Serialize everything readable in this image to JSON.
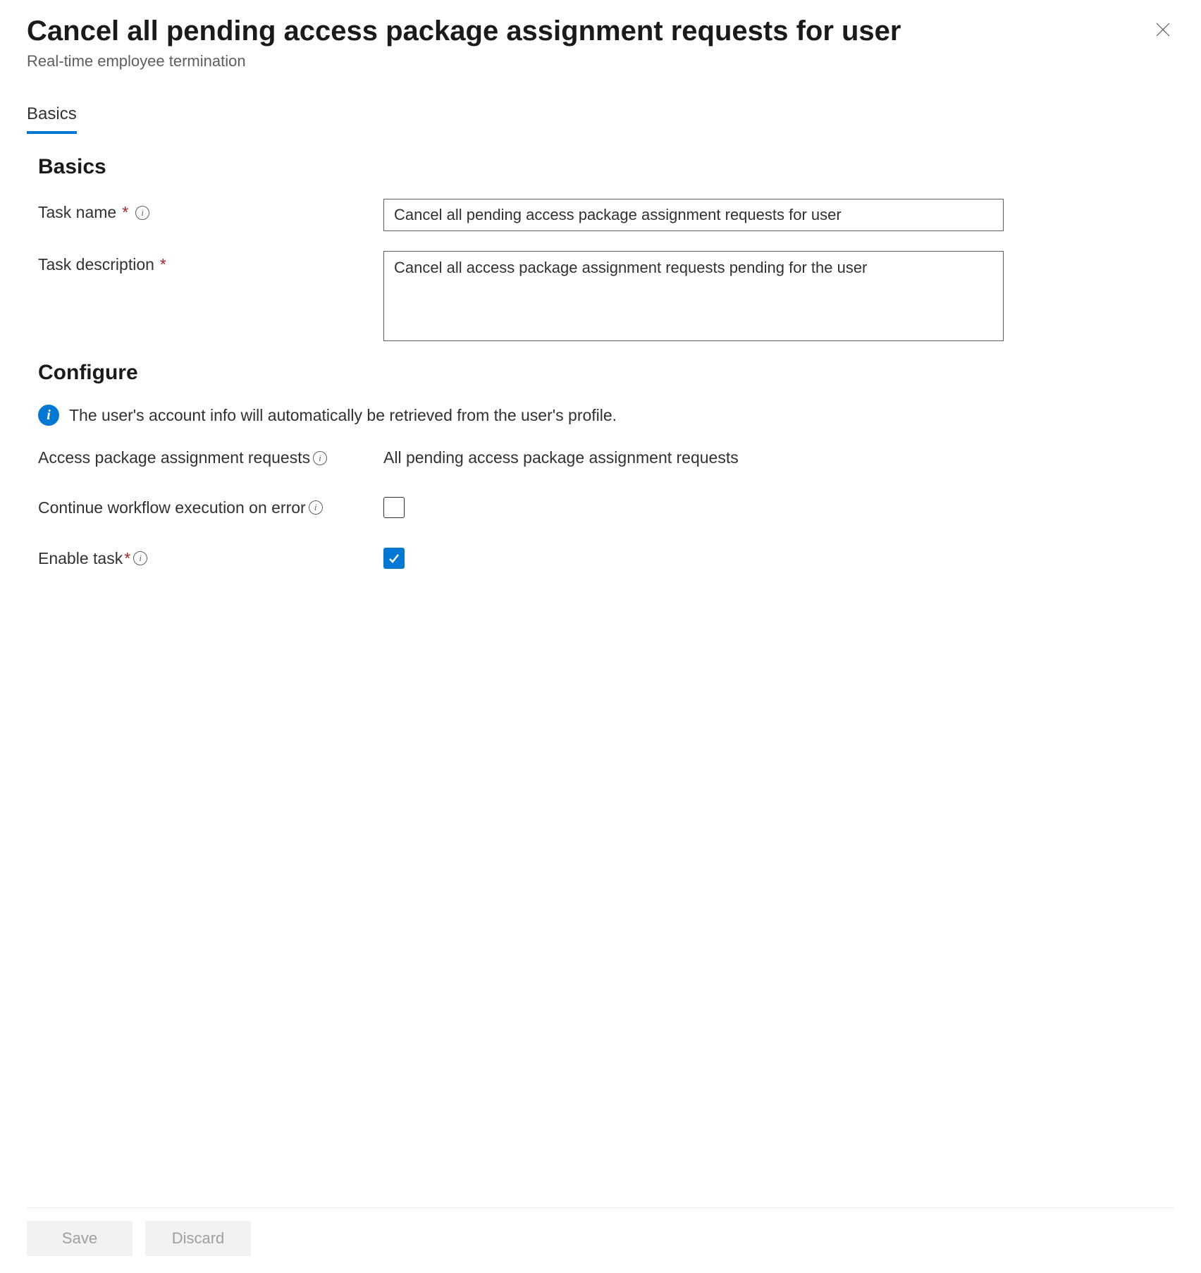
{
  "header": {
    "title": "Cancel all pending access package assignment requests for user",
    "subtitle": "Real-time employee termination"
  },
  "tabs": {
    "basics": "Basics"
  },
  "sections": {
    "basics_heading": "Basics",
    "configure_heading": "Configure"
  },
  "form": {
    "task_name_label": "Task name",
    "task_name_value": "Cancel all pending access package assignment requests for user",
    "task_description_label": "Task description",
    "task_description_value": "Cancel all access package assignment requests pending for the user"
  },
  "configure": {
    "info_banner": "The user's account info will automatically be retrieved from the user's profile.",
    "access_requests_label": "Access package assignment requests",
    "access_requests_value": "All pending access package assignment requests",
    "continue_on_error_label": "Continue workflow execution on error",
    "continue_on_error_checked": false,
    "enable_task_label": "Enable task",
    "enable_task_checked": true
  },
  "footer": {
    "save": "Save",
    "discard": "Discard"
  }
}
